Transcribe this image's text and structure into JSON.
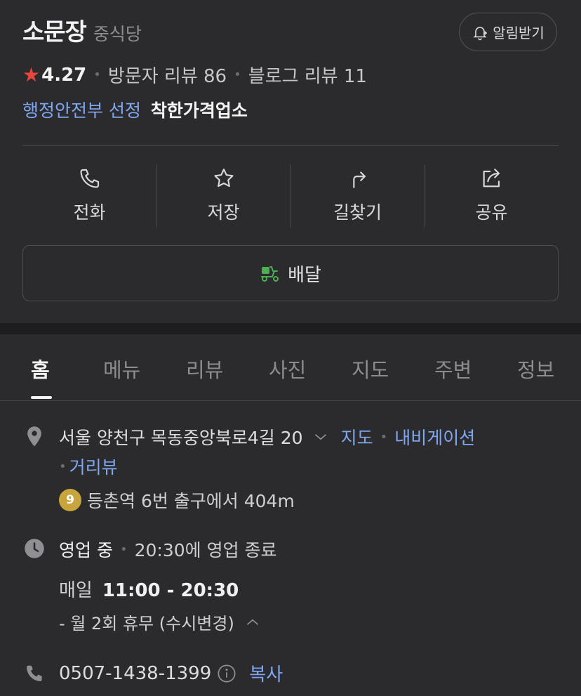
{
  "place": {
    "name": "소문장",
    "category": "중식당",
    "notify_label": "알림받기",
    "rating": "4.27",
    "visitor_review_label": "방문자 리뷰 86",
    "blog_review_label": "블로그 리뷰 11",
    "gov_label": "행정안전부 선정",
    "gov_badge": "착한가격업소"
  },
  "actions": [
    {
      "label": "전화",
      "icon": "phone-icon"
    },
    {
      "label": "저장",
      "icon": "star-outline-icon"
    },
    {
      "label": "길찾기",
      "icon": "directions-icon"
    },
    {
      "label": "공유",
      "icon": "share-icon"
    }
  ],
  "delivery": {
    "label": "배달",
    "icon": "delivery-scooter-icon",
    "color": "#4caf50"
  },
  "tabs": [
    "홈",
    "메뉴",
    "리뷰",
    "사진",
    "지도",
    "주변",
    "정보"
  ],
  "active_tab": "홈",
  "info": {
    "address": "서울 양천구 목동중앙북로4길 20",
    "map_link": "지도",
    "navi_link": "내비게이션",
    "streetview_link": "거리뷰",
    "subway_line": "9",
    "subway_text": "등촌역 6번 출구에서 404m",
    "open_status": "영업 중",
    "close_info": "20:30에 영업 종료",
    "hours_day": "매일",
    "hours_time": "11:00 - 20:30",
    "holiday": "- 월 2회 휴무 (수시변경)",
    "phone": "0507-1438-1399",
    "copy_label": "복사"
  },
  "colors": {
    "background": "#2b2b2d",
    "link": "#7fa7f0",
    "star": "#e8453c",
    "subway_line_9": "#c9a43c"
  }
}
